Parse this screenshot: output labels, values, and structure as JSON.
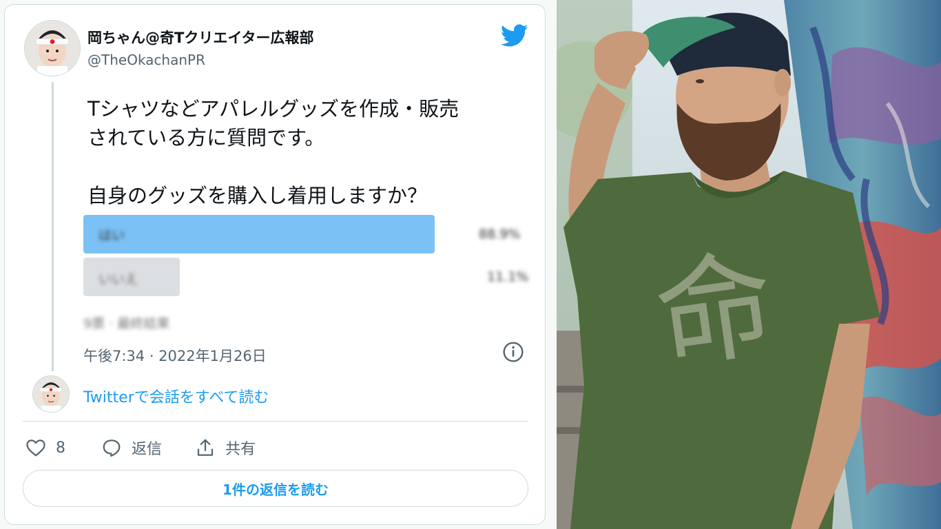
{
  "tweet": {
    "display_name": "岡ちゃん@奇Tクリエイター広報部",
    "handle": "@TheOkachanPR",
    "text": "Tシャツなどアパレルグッズを作成・販売\nされている方に質問です。\n\n自身のグッズを購入し着用しますか？",
    "poll": {
      "options": [
        {
          "label": "はい",
          "percent": 88.9,
          "percent_text": "88.9%"
        },
        {
          "label": "いいえ",
          "percent": 11.1,
          "percent_text": "11.1%"
        }
      ],
      "meta": "9票 · 最終結果"
    },
    "timestamp": "午後7:34 · 2022年1月26日",
    "read_conversation": "Twitterで会話をすべて読む",
    "actions": {
      "like_count": "8",
      "reply_label": "返信",
      "share_label": "共有"
    },
    "read_replies_button": "1件の返信を読む"
  },
  "photo": {
    "shirt_kanji": "命"
  },
  "colors": {
    "twitter_blue": "#1d9bf0",
    "poll_winner": "#7cc1f5",
    "poll_other": "#dcdfe2",
    "shirt_green": "#4f6a3c"
  },
  "icons": [
    "twitter-bird-icon",
    "info-icon",
    "heart-icon",
    "comment-icon",
    "share-icon"
  ]
}
